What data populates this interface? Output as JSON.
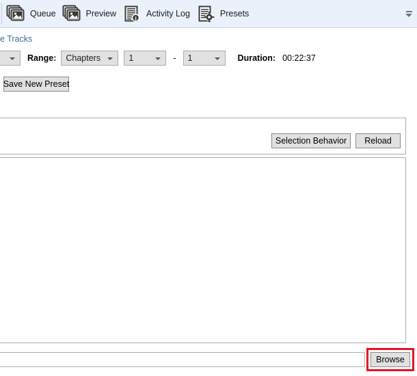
{
  "toolbar": {
    "items": [
      {
        "label": "Queue",
        "icon": "images-stack-icon"
      },
      {
        "label": "Preview",
        "icon": "images-stack-icon"
      },
      {
        "label": "Activity Log",
        "icon": "document-info-icon"
      },
      {
        "label": "Presets",
        "icon": "document-gear-icon"
      }
    ],
    "collapse_icon": "chevron-down-icon"
  },
  "source": {
    "section_label": "e Tracks",
    "track_select_value": "",
    "range_label": "Range:",
    "range_type_value": "Chapters",
    "range_start_value": "1",
    "range_separator": "-",
    "range_end_value": "1",
    "duration_label": "Duration:",
    "duration_value": "00:22:37"
  },
  "presets": {
    "save_new_preset_label": "Save New Preset"
  },
  "panel": {
    "selection_behavior_label": "Selection Behavior",
    "reload_label": "Reload"
  },
  "destination": {
    "path_value": "",
    "path_placeholder": "",
    "browse_label": "Browse"
  },
  "colors": {
    "toolbar_background": "#eaf1fb",
    "section_label": "#41699b",
    "button_face": "#e1e1e1",
    "highlight": "#e81123"
  }
}
